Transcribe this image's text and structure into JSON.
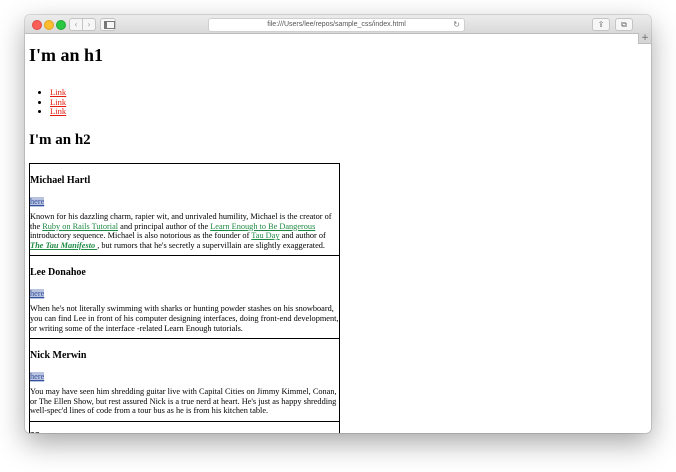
{
  "browser": {
    "address": "file:///Users/lee/repos/sample_css/index.html",
    "back_glyph": "‹",
    "forward_glyph": "›",
    "reload_glyph": "↻",
    "share_glyph": "⇪",
    "tabs_glyph": "⧉",
    "newtab_glyph": "+"
  },
  "page": {
    "h1": "I'm an h1",
    "links": [
      "Link",
      "Link",
      "Link"
    ],
    "h2": "I'm an h2",
    "bios": [
      {
        "name": "Michael Hartl",
        "here": "here",
        "text_1": "Known for his dazzling charm, rapier wit, and unrivaled humility, Michael is the creator of the ",
        "link_1": "Ruby on Rails Tutorial",
        "text_2": " and principal author of the ",
        "link_2": "Learn Enough to Be Dangerous",
        "text_3": " introductory sequence. Michael is also notorious as the founder of ",
        "link_3": "Tau Day",
        "text_4": " and author of ",
        "link_4": "The Tau Manifesto ",
        "text_5": ", but rumors that he's secretly a supervillain are slightly exaggerated."
      },
      {
        "name": "Lee Donahoe",
        "here": "here",
        "text": "When he's not literally swimming with sharks or hunting powder stashes on his snowboard, you can find Lee in front of his computer designing interfaces, doing front-end development, or writing some of the interface -related Learn Enough tutorials."
      },
      {
        "name": "Nick Merwin",
        "here": "here",
        "text": "You may have seen him shredding guitar live with Capital Cities on Jimmy Kimmel, Conan, or The Ellen Show, but rest assured Nick is a true nerd at heart. He's just as happy shredding well-spec'd lines of code from a tour bus as he is from his kitchen table."
      },
      {
        "name": "??"
      }
    ]
  }
}
